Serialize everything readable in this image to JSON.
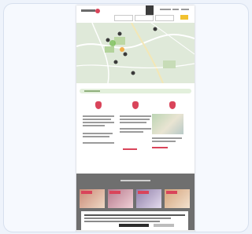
{
  "colors": {
    "accent": "#d9445a",
    "search_button": "#3c3c3c",
    "go_button": "#f2c230",
    "map_bg": "#dfe9d9",
    "map_pin": "#3a3a3a",
    "footer_bg": "#6f6f6f"
  },
  "icons": {
    "logo": "brand-logo-icon",
    "search_button": "search-icon",
    "map_pin": "map-pin-icon",
    "feature_pin": "location-pin-icon",
    "toggle": "circle-toggle-icon"
  }
}
